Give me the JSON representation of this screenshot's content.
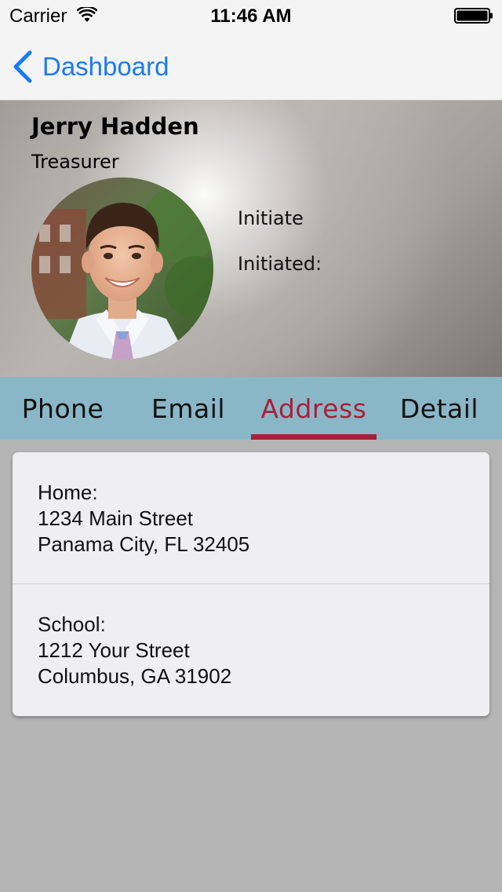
{
  "status_bar": {
    "carrier": "Carrier",
    "time": "11:46 AM"
  },
  "nav": {
    "back_label": "Dashboard",
    "accent_color": "#1a7bf0"
  },
  "profile": {
    "name": "Jerry Hadden",
    "role": "Treasurer",
    "initiate_label": "Initiate",
    "initiated_label": "Initiated:"
  },
  "tabs": [
    {
      "label": "Phone",
      "active": false
    },
    {
      "label": "Email",
      "active": false
    },
    {
      "label": "Address",
      "active": true
    },
    {
      "label": "Detail",
      "active": false
    }
  ],
  "tab_colors": {
    "bar": "#8ab7c7",
    "active": "#a8203a"
  },
  "addresses": {
    "home": {
      "label": "Home:",
      "line1": "1234 Main Street",
      "line2": "Panama City, FL 32405"
    },
    "school": {
      "label": "School:",
      "line1": "1212 Your Street",
      "line2": "Columbus, GA 31902"
    }
  },
  "icons": {
    "back": "chevron-left-icon",
    "wifi": "wifi-icon",
    "battery": "battery-icon"
  }
}
